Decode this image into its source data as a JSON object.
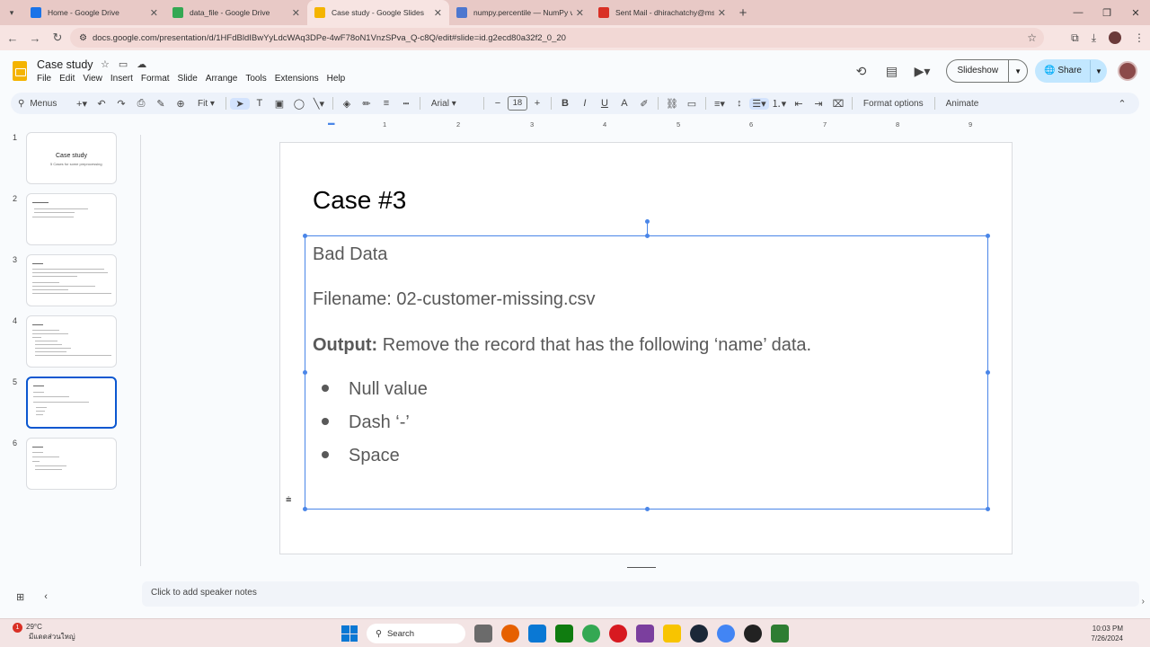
{
  "browser": {
    "tabs": [
      {
        "title": "Home - Google Drive",
        "color": "#1a73e8"
      },
      {
        "title": "data_file - Google Drive",
        "color": "#1a73e8"
      },
      {
        "title": "Case study - Google Slides",
        "color": "#f4b400",
        "active": true
      },
      {
        "title": "numpy.percentile — NumPy v2.",
        "color": "#4d77cf"
      },
      {
        "title": "Sent Mail - dhirachatchy@msm",
        "color": "#d93025"
      }
    ],
    "url": "docs.google.com/presentation/d/1HFdBldIBwYyLdcWAq3DPe-4wF78oN1VnzSPva_Q-c8Q/edit#slide=id.g2ecd80a32f2_0_20"
  },
  "app": {
    "doc_title": "Case study",
    "menu": [
      "File",
      "Edit",
      "View",
      "Insert",
      "Format",
      "Slide",
      "Arrange",
      "Tools",
      "Extensions",
      "Help"
    ],
    "slideshow_label": "Slideshow",
    "share_label": "Share"
  },
  "toolbar": {
    "menus_label": "Menus",
    "zoom": "Fit",
    "font": "Arial",
    "font_size": "18",
    "format_options": "Format options",
    "animate": "Animate"
  },
  "ruler": [
    "1",
    "2",
    "3",
    "4",
    "5",
    "6",
    "7",
    "8",
    "9"
  ],
  "filmstrip": {
    "numbers": [
      "1",
      "2",
      "3",
      "4",
      "5",
      "6"
    ],
    "thumb1_title": "Case study",
    "thumb1_sub": "5 Cases for some preprocessing"
  },
  "slide": {
    "title": "Case #3",
    "line1": "Bad Data",
    "line2": "Filename: 02-customer-missing.csv",
    "output_label": "Output:",
    "output_text": " Remove the record that has the following ‘name’ data.",
    "bullets": [
      "Null value",
      "Dash ‘-’",
      "Space"
    ]
  },
  "notes": {
    "placeholder": "Click to add speaker notes"
  },
  "taskbar": {
    "weather_temp": "29°C",
    "weather_desc": "มีแดดส่วนใหญ่",
    "weather_badge": "1",
    "search_label": "Search",
    "time": "10:03 PM",
    "date": "7/26/2024"
  }
}
